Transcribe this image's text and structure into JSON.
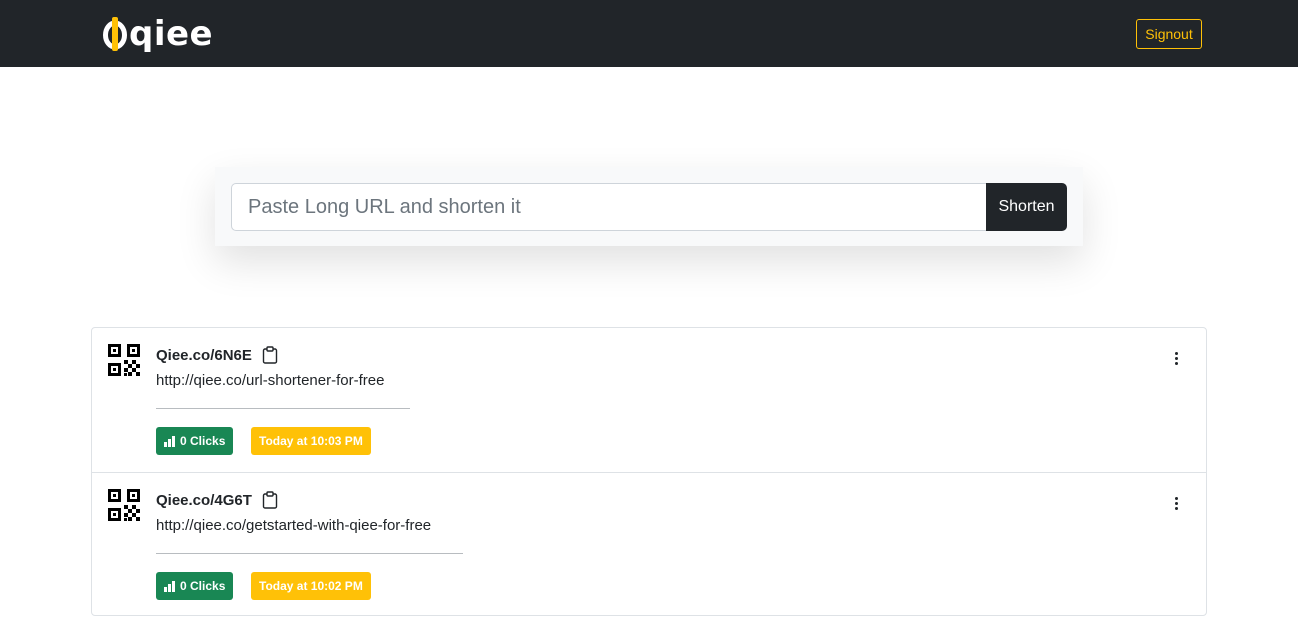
{
  "navbar": {
    "logo_text": "qiee",
    "signout_label": "Signout",
    "brand_color": "#ffc107",
    "background": "#212529"
  },
  "shortener": {
    "input_value": "",
    "input_placeholder": "Paste Long URL and shorten it",
    "button_label": "Shorten"
  },
  "links": [
    {
      "short_url": "Qiee.co/6N6E",
      "long_url": "http://qiee.co/url-shortener-for-free",
      "clicks_label": "0 Clicks",
      "created_label": "Today at 10:03 PM"
    },
    {
      "short_url": "Qiee.co/4G6T",
      "long_url": "http://qiee.co/getstarted-with-qiee-for-free",
      "clicks_label": "0 Clicks",
      "created_label": "Today at 10:02 PM"
    }
  ],
  "icons": {
    "qr": "qr-code-icon",
    "clipboard": "clipboard-icon",
    "bar_chart": "bar-chart-icon",
    "menu": "kebab-menu-icon"
  }
}
